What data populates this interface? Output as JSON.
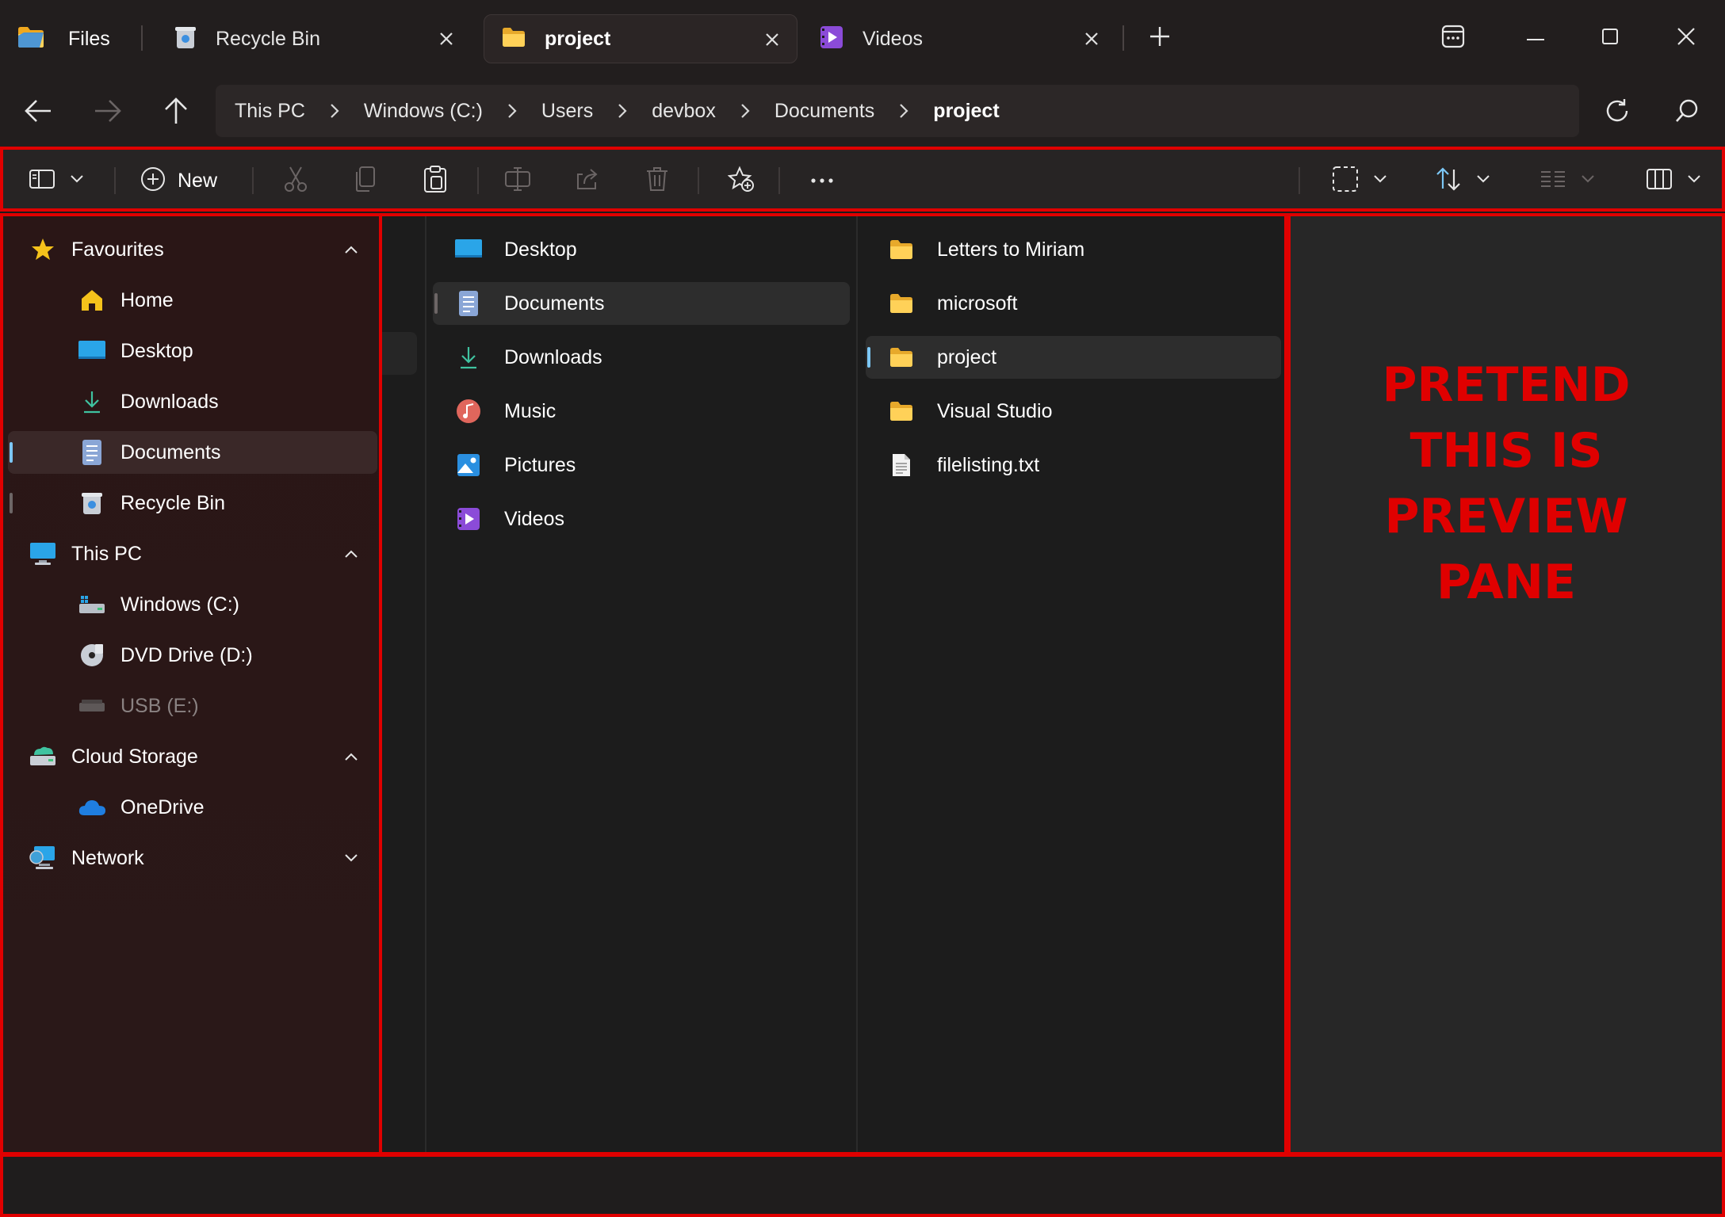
{
  "titlebar": {
    "app_name": "Files",
    "tabs": [
      {
        "label": "Recycle Bin",
        "active": false
      },
      {
        "label": "project",
        "active": true
      },
      {
        "label": "Videos",
        "active": false
      }
    ]
  },
  "breadcrumb": [
    "This PC",
    "Windows (C:)",
    "Users",
    "devbox",
    "Documents",
    "project"
  ],
  "toolbar": {
    "new_label": "New"
  },
  "sidebar": {
    "favourites": "Favourites",
    "fav_items": [
      "Home",
      "Desktop",
      "Downloads",
      "Documents",
      "Recycle Bin"
    ],
    "this_pc": "This PC",
    "pc_items": [
      "Windows (C:)",
      "DVD Drive (D:)",
      "USB (E:)"
    ],
    "cloud": "Cloud Storage",
    "cloud_items": [
      "OneDrive"
    ],
    "network": "Network"
  },
  "columns": {
    "col2": [
      "Desktop",
      "Documents",
      "Downloads",
      "Music",
      "Pictures",
      "Videos"
    ],
    "col3": [
      "Letters to Miriam",
      "microsoft",
      "project",
      "Visual Studio",
      "filelisting.txt"
    ]
  },
  "preview": {
    "line1": "PRETEND",
    "line2": "THIS IS",
    "line3": "PREVIEW",
    "line4": "PANE"
  },
  "colors": {
    "accent": "#7cc7f5",
    "annotation": "#e00000",
    "folder": "#f5c542"
  }
}
